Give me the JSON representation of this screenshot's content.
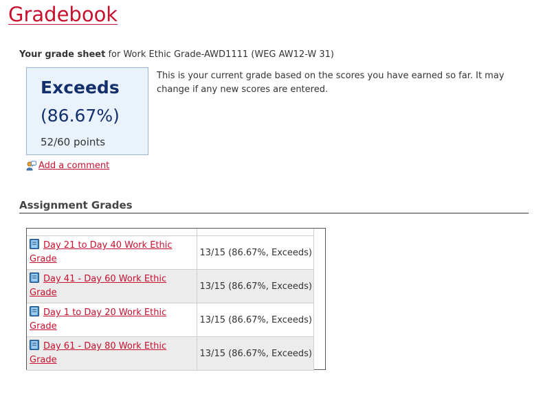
{
  "page": {
    "title": "Gradebook"
  },
  "grade_sheet": {
    "heading_bold": "Your grade sheet",
    "heading_rest": " for Work Ethic Grade-AWD1111 (WEG AW12-W 31)",
    "grade_label": "Exceeds",
    "grade_percent": "(86.67%)",
    "grade_points": "52/60 points",
    "description": "This is your current grade based on the scores you have earned so far. It may change if any new scores are entered.",
    "comment_link": " Add a comment"
  },
  "assignments": {
    "title": "Assignment Grades",
    "rows": [
      {
        "name": "Day 21 to Day 40 Work Ethic Grade",
        "score": "13/15 (86.67%, Exceeds)"
      },
      {
        "name": "Day 41 - Day 60 Work Ethic Grade",
        "score": "13/15 (86.67%, Exceeds)"
      },
      {
        "name": "Day 1 to Day 20 Work Ethic Grade",
        "score": "13/15 (86.67%, Exceeds)"
      },
      {
        "name": "Day 61 - Day 80 Work Ethic Grade",
        "score": "13/15 (86.67%, Exceeds)"
      }
    ]
  },
  "colors": {
    "link": "#c8102e",
    "grade_text": "#12306b",
    "grade_box_bg": "#eaf2fb",
    "alt_row_bg": "#ececec"
  },
  "icons": {
    "comment": "comment-icon",
    "assignment": "book-icon"
  }
}
